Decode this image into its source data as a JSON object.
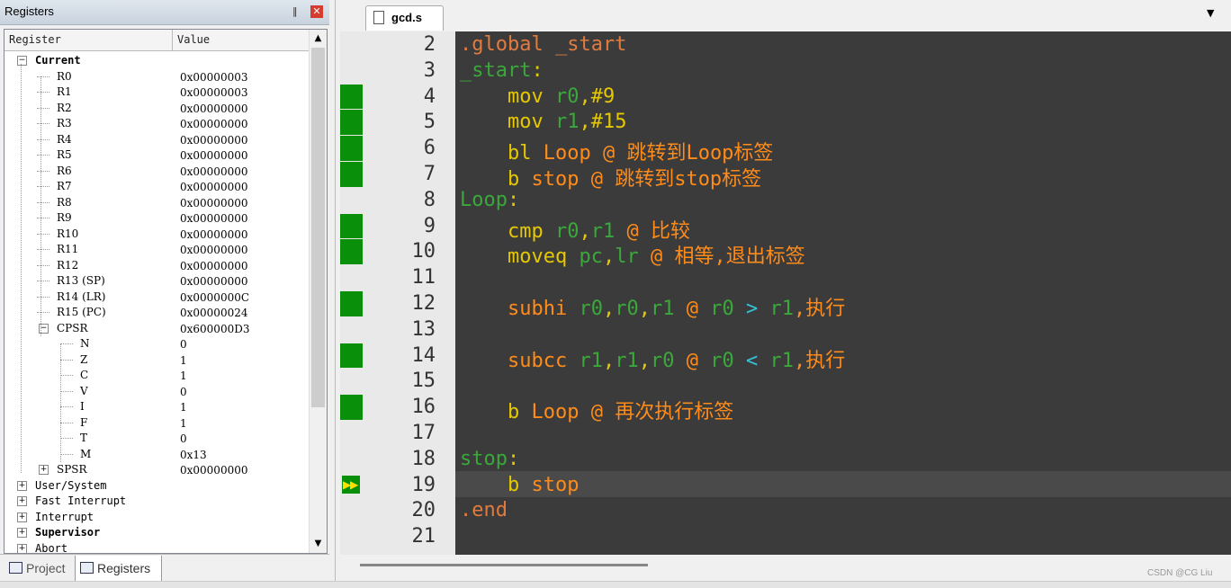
{
  "registers_pane": {
    "title": "Registers",
    "header": {
      "register": "Register",
      "value": "Value"
    },
    "current_label": "Current",
    "regs": [
      {
        "name": "R0",
        "value": "0x00000003"
      },
      {
        "name": "R1",
        "value": "0x00000003"
      },
      {
        "name": "R2",
        "value": "0x00000000"
      },
      {
        "name": "R3",
        "value": "0x00000000"
      },
      {
        "name": "R4",
        "value": "0x00000000"
      },
      {
        "name": "R5",
        "value": "0x00000000"
      },
      {
        "name": "R6",
        "value": "0x00000000"
      },
      {
        "name": "R7",
        "value": "0x00000000"
      },
      {
        "name": "R8",
        "value": "0x00000000"
      },
      {
        "name": "R9",
        "value": "0x00000000"
      },
      {
        "name": "R10",
        "value": "0x00000000"
      },
      {
        "name": "R11",
        "value": "0x00000000"
      },
      {
        "name": "R12",
        "value": "0x00000000"
      },
      {
        "name": "R13 (SP)",
        "value": "0x00000000"
      },
      {
        "name": "R14 (LR)",
        "value": "0x0000000C"
      },
      {
        "name": "R15 (PC)",
        "value": "0x00000024"
      }
    ],
    "cpsr": {
      "name": "CPSR",
      "value": "0x600000D3"
    },
    "flags": [
      {
        "name": "N",
        "value": "0"
      },
      {
        "name": "Z",
        "value": "1"
      },
      {
        "name": "C",
        "value": "1"
      },
      {
        "name": "V",
        "value": "0"
      },
      {
        "name": "I",
        "value": "1"
      },
      {
        "name": "F",
        "value": "1"
      },
      {
        "name": "T",
        "value": "0"
      },
      {
        "name": "M",
        "value": "0x13"
      }
    ],
    "spsr": {
      "name": "SPSR",
      "value": "0x00000000"
    },
    "modes": [
      "User/System",
      "Fast Interrupt",
      "Interrupt",
      "Supervisor",
      "Abort"
    ],
    "bold_mode": "Supervisor"
  },
  "bottom_tabs": {
    "project": "Project",
    "registers": "Registers"
  },
  "editor": {
    "file_tab": "gcd.s",
    "breakpoint_lines": [
      4,
      5,
      6,
      7,
      9,
      10,
      12,
      14,
      16
    ],
    "current_line": 19,
    "lines": [
      {
        "n": "2",
        "tokens": [
          [
            "dir",
            ".global _start"
          ]
        ]
      },
      {
        "n": "3",
        "tokens": [
          [
            "lbl",
            "_start"
          ],
          [
            "op",
            ":"
          ]
        ]
      },
      {
        "n": "4",
        "tokens": [
          [
            "ws",
            "    "
          ],
          [
            "kw",
            "mov"
          ],
          [
            "ws",
            " "
          ],
          [
            "reg",
            "r0"
          ],
          [
            "op",
            ",#9"
          ]
        ]
      },
      {
        "n": "5",
        "tokens": [
          [
            "ws",
            "    "
          ],
          [
            "kw",
            "mov"
          ],
          [
            "ws",
            " "
          ],
          [
            "reg",
            "r1"
          ],
          [
            "op",
            ",#15"
          ]
        ]
      },
      {
        "n": "6",
        "tokens": [
          [
            "ws",
            "    "
          ],
          [
            "kw",
            "bl"
          ],
          [
            "ws",
            " "
          ],
          [
            "cmt",
            "Loop @ 跳转到Loop标签"
          ]
        ]
      },
      {
        "n": "7",
        "tokens": [
          [
            "ws",
            "    "
          ],
          [
            "kw",
            "b"
          ],
          [
            "ws",
            " "
          ],
          [
            "cmt",
            "stop @ 跳转到stop标签"
          ]
        ]
      },
      {
        "n": "8",
        "tokens": [
          [
            "lbl",
            "Loop"
          ],
          [
            "op",
            ":"
          ]
        ]
      },
      {
        "n": "9",
        "tokens": [
          [
            "ws",
            "    "
          ],
          [
            "kw",
            "cmp"
          ],
          [
            "ws",
            " "
          ],
          [
            "reg",
            "r0"
          ],
          [
            "op",
            ","
          ],
          [
            "reg",
            "r1"
          ],
          [
            "ws",
            " "
          ],
          [
            "cmt",
            "@ 比较"
          ]
        ]
      },
      {
        "n": "10",
        "tokens": [
          [
            "ws",
            "    "
          ],
          [
            "kw",
            "moveq"
          ],
          [
            "ws",
            " "
          ],
          [
            "reg",
            "pc"
          ],
          [
            "op",
            ","
          ],
          [
            "reg",
            "lr"
          ],
          [
            "ws",
            " "
          ],
          [
            "cmt",
            "@ 相等,退出标签"
          ]
        ]
      },
      {
        "n": "11",
        "tokens": []
      },
      {
        "n": "12",
        "tokens": [
          [
            "ws",
            "    "
          ],
          [
            "cmt",
            "subhi "
          ],
          [
            "reg",
            "r0"
          ],
          [
            "op",
            ","
          ],
          [
            "reg",
            "r0"
          ],
          [
            "op",
            ","
          ],
          [
            "reg",
            "r1"
          ],
          [
            "ws",
            " "
          ],
          [
            "cmt",
            "@ "
          ],
          [
            "reg",
            "r0"
          ],
          [
            "ws",
            " "
          ],
          [
            "cyan",
            ">"
          ],
          [
            "ws",
            " "
          ],
          [
            "reg",
            "r1"
          ],
          [
            "cmt",
            ",执行"
          ]
        ]
      },
      {
        "n": "13",
        "tokens": []
      },
      {
        "n": "14",
        "tokens": [
          [
            "ws",
            "    "
          ],
          [
            "cmt",
            "subcc "
          ],
          [
            "reg",
            "r1"
          ],
          [
            "op",
            ","
          ],
          [
            "reg",
            "r1"
          ],
          [
            "op",
            ","
          ],
          [
            "reg",
            "r0"
          ],
          [
            "ws",
            " "
          ],
          [
            "cmt",
            "@ "
          ],
          [
            "reg",
            "r0"
          ],
          [
            "ws",
            " "
          ],
          [
            "cyan",
            "<"
          ],
          [
            "ws",
            " "
          ],
          [
            "reg",
            "r1"
          ],
          [
            "cmt",
            ",执行"
          ]
        ]
      },
      {
        "n": "15",
        "tokens": []
      },
      {
        "n": "16",
        "tokens": [
          [
            "ws",
            "    "
          ],
          [
            "kw",
            "b"
          ],
          [
            "ws",
            " "
          ],
          [
            "cmt",
            "Loop @ 再次执行标签"
          ]
        ]
      },
      {
        "n": "17",
        "tokens": []
      },
      {
        "n": "18",
        "tokens": [
          [
            "lbl",
            "stop"
          ],
          [
            "op",
            ":"
          ]
        ]
      },
      {
        "n": "19",
        "tokens": [
          [
            "ws",
            "    "
          ],
          [
            "kw",
            "b"
          ],
          [
            "ws",
            " "
          ],
          [
            "cmt",
            "stop"
          ]
        ]
      },
      {
        "n": "20",
        "tokens": [
          [
            "dir",
            ".end"
          ]
        ]
      },
      {
        "n": "21",
        "tokens": []
      }
    ]
  },
  "watermark": "CSDN @CG Liu",
  "colors": {
    "breakpoint": "#0a8f0a",
    "code_bg": "#3b3b3b",
    "gutter_bg": "#e9e9e9"
  },
  "icons": [
    "pin-icon",
    "close-icon",
    "expand-icon",
    "collapse-icon",
    "file-icon",
    "dropdown-icon",
    "exec-arrow-icon",
    "scroll-up-icon",
    "scroll-down-icon",
    "project-tab-icon",
    "registers-tab-icon"
  ]
}
